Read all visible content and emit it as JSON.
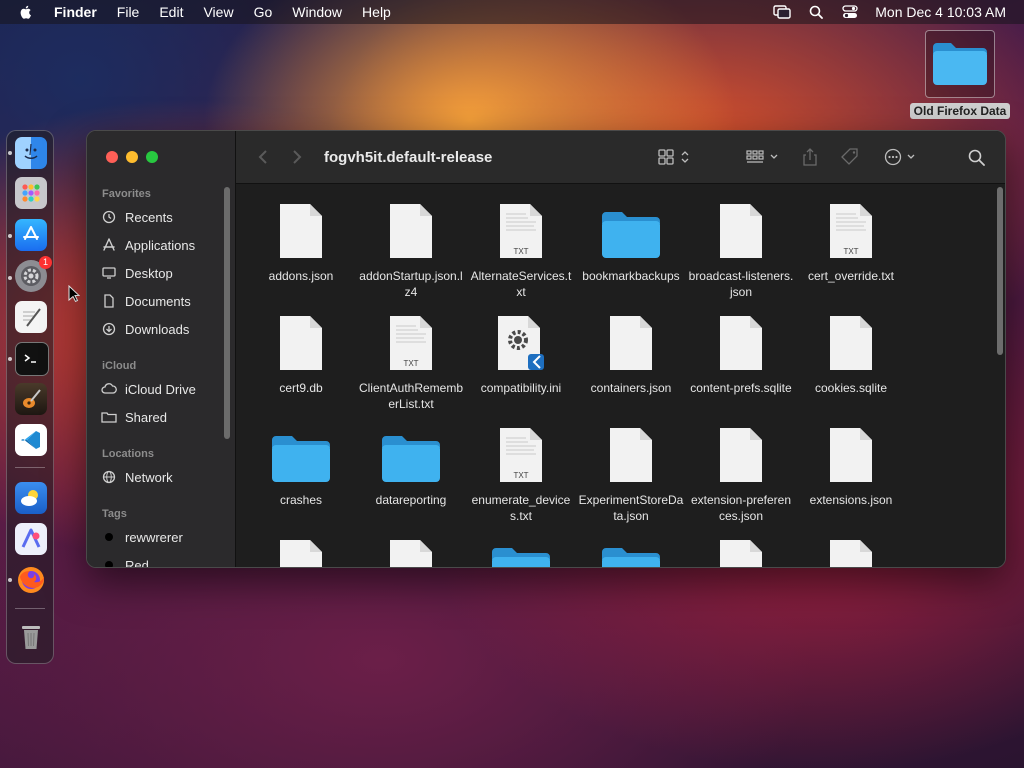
{
  "menubar": {
    "app": "Finder",
    "items": [
      "File",
      "Edit",
      "View",
      "Go",
      "Window",
      "Help"
    ],
    "clock": "Mon Dec 4  10:03 AM"
  },
  "desktop": {
    "folder_label": "Old Firefox Data"
  },
  "dock": {
    "settings_badge": "1"
  },
  "window": {
    "title": "fogvh5it.default-release",
    "sidebar": {
      "favorites_header": "Favorites",
      "favorites": [
        "Recents",
        "Applications",
        "Desktop",
        "Documents",
        "Downloads"
      ],
      "icloud_header": "iCloud",
      "icloud": [
        "iCloud Drive",
        "Shared"
      ],
      "locations_header": "Locations",
      "locations": [
        "Network"
      ],
      "tags_header": "Tags",
      "tags": [
        {
          "label": "rewwrerer",
          "color": "#000000"
        },
        {
          "label": "Red",
          "color": "#000000"
        }
      ]
    },
    "files": [
      {
        "name": "addons.json",
        "kind": "doc"
      },
      {
        "name": "addonStartup.json.lz4",
        "kind": "doc"
      },
      {
        "name": "AlternateServices.txt",
        "kind": "txt"
      },
      {
        "name": "bookmarkbackups",
        "kind": "folder"
      },
      {
        "name": "broadcast-listeners.json",
        "kind": "doc"
      },
      {
        "name": "cert_override.txt",
        "kind": "txt"
      },
      {
        "name": "cert9.db",
        "kind": "doc"
      },
      {
        "name": "ClientAuthRememberList.txt",
        "kind": "txt"
      },
      {
        "name": "compatibility.ini",
        "kind": "ini"
      },
      {
        "name": "containers.json",
        "kind": "doc"
      },
      {
        "name": "content-prefs.sqlite",
        "kind": "doc"
      },
      {
        "name": "cookies.sqlite",
        "kind": "doc"
      },
      {
        "name": "crashes",
        "kind": "folder"
      },
      {
        "name": "datareporting",
        "kind": "folder"
      },
      {
        "name": "enumerate_devices.txt",
        "kind": "txt"
      },
      {
        "name": "ExperimentStoreData.json",
        "kind": "doc"
      },
      {
        "name": "extension-preferences.json",
        "kind": "doc"
      },
      {
        "name": "extensions.json",
        "kind": "doc"
      },
      {
        "name": "",
        "kind": "doc"
      },
      {
        "name": "",
        "kind": "doc"
      },
      {
        "name": "",
        "kind": "folder"
      },
      {
        "name": "",
        "kind": "folder"
      },
      {
        "name": "",
        "kind": "doc"
      },
      {
        "name": "",
        "kind": "doc"
      }
    ],
    "txt_label": "TXT"
  },
  "colors": {
    "folder_blue": "#3fb2ef",
    "traffic_close": "#fe5f57",
    "traffic_min": "#febc2e",
    "traffic_max": "#28c840"
  }
}
